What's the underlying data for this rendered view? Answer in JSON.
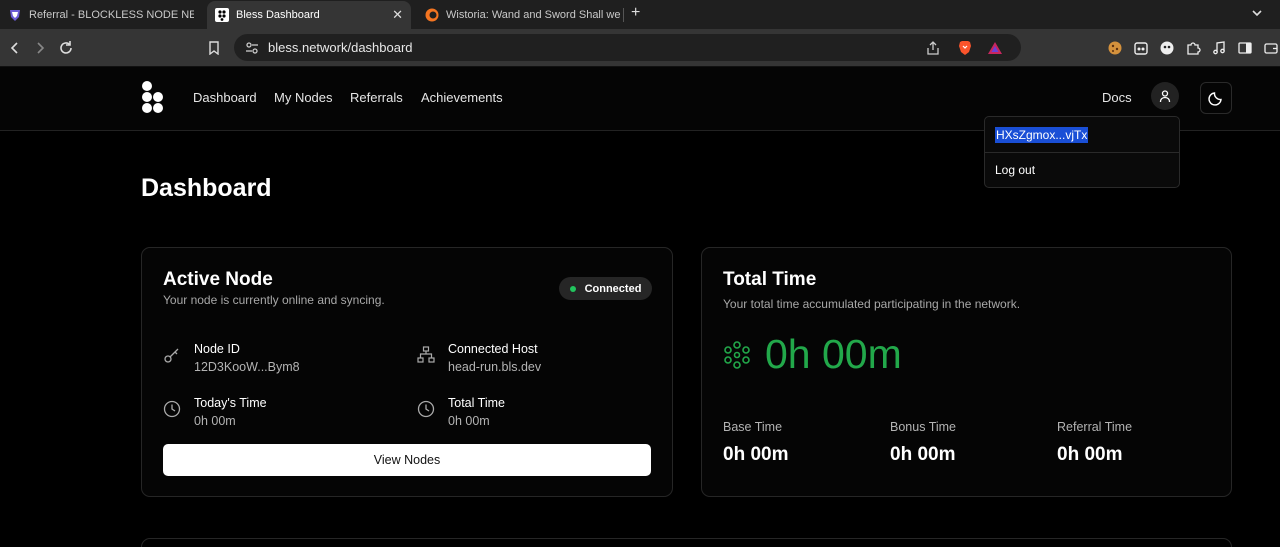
{
  "browser": {
    "tabs": [
      {
        "title": "Referral - BLOCKLESS NODE NEW R",
        "active": false
      },
      {
        "title": "Bless Dashboard",
        "active": true
      },
      {
        "title": "Wistoria: Wand and Sword Shall we",
        "active": false
      }
    ],
    "url": "bless.network/dashboard"
  },
  "header": {
    "nav": [
      "Dashboard",
      "My Nodes",
      "Referrals",
      "Achievements"
    ],
    "docs": "Docs"
  },
  "dropdown": {
    "address": "HXsZgmox...vjTx",
    "logout": "Log out"
  },
  "page_title": "Dashboard",
  "active_node": {
    "title": "Active Node",
    "subtitle": "Your node is currently online and syncing.",
    "status": "Connected",
    "node_id_label": "Node ID",
    "node_id": "12D3KooW...Bym8",
    "host_label": "Connected Host",
    "host": "head-run.bls.dev",
    "today_label": "Today's Time",
    "today": "0h 00m",
    "total_label": "Total Time",
    "total": "0h 00m",
    "view_nodes": "View Nodes"
  },
  "total_time": {
    "title": "Total Time",
    "subtitle": "Your total time accumulated participating in the network.",
    "value": "0h 00m",
    "base_label": "Base Time",
    "base": "0h 00m",
    "bonus_label": "Bonus Time",
    "bonus": "0h 00m",
    "referral_label": "Referral Time",
    "referral": "0h 00m"
  },
  "colors": {
    "accent_green": "#22a84a",
    "status_dot": "#22c55e",
    "selection": "#1a4fd6"
  }
}
